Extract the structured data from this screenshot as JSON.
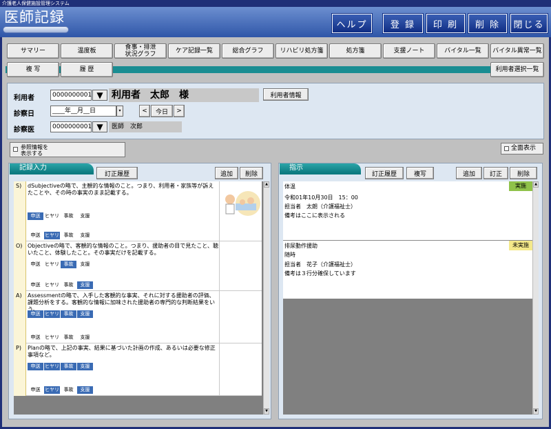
{
  "window": {
    "system_title": "介護老人保健施設管理システム",
    "app_title": "医師記録"
  },
  "header_buttons": {
    "help": "ヘルプ",
    "register": "登 録",
    "print": "印 刷",
    "delete": "削 除",
    "close": "閉じる"
  },
  "tabs_row1": [
    "サマリー",
    "温度板",
    "食事・排泄\n状況グラフ",
    "ケア記録一覧",
    "総合グラフ",
    "リハビリ処方箋",
    "処方箋",
    "支援ノート",
    "バイタル一覧",
    "バイタル異常一覧"
  ],
  "tabs_row2": {
    "copy": "複 写",
    "history": "履 歴",
    "user_select": "利用者選択一覧"
  },
  "user": {
    "label": "利用者",
    "id": "0000000001",
    "name": "利用者　太郎　様",
    "info_button": "利用者情報",
    "date_label": "診察日",
    "date_value": "____年__月__日",
    "prev": "<",
    "today": "今日",
    "next": ">",
    "doctor_label": "診察医",
    "doctor_id": "0000000001",
    "doctor_name": "医師　次郎"
  },
  "options": {
    "reference": "参照情報を\n表示する",
    "fullscreen": "全面表示"
  },
  "record_panel": {
    "title": "記録入力",
    "fix_history": "訂正履歴",
    "add": "追加",
    "delete": "削除",
    "entries": [
      {
        "letter": "S)",
        "text": "dSubjectiveの略で、主観的な情報のこと。つまり、利用者・家族等が訴えたことや、その時の事実のまま記載する。",
        "chips": [
          [
            "申送",
            1
          ],
          [
            "ヒヤリ",
            0
          ],
          [
            "事故",
            0
          ],
          [
            "支援",
            0
          ]
        ],
        "chips2": [
          [
            "申送",
            0
          ],
          [
            "ヒヤリ",
            1
          ],
          [
            "事故",
            0
          ],
          [
            "支援",
            0
          ]
        ]
      },
      {
        "letter": "O)",
        "text": "Objectiveの略で、客観的な情報のこと。つまり、援助者の目で見たこと、聴いたこと、体験したこと。その事実だけを記載する。",
        "chips": [
          [
            "申送",
            0
          ],
          [
            "ヒヤリ",
            0
          ],
          [
            "事故",
            1
          ],
          [
            "支援",
            0
          ]
        ],
        "chips2": [
          [
            "申送",
            0
          ],
          [
            "ヒヤリ",
            0
          ],
          [
            "事故",
            0
          ],
          [
            "支援",
            1
          ]
        ]
      },
      {
        "letter": "A)",
        "text": "Assessmentの略で、入手した客観的な事実、それに対する援助者の評価、課題分析をする。客観的な情報に加味された援助者の専門的な判断結果をいう。",
        "chips": [
          [
            "申送",
            1
          ],
          [
            "ヒヤリ",
            1
          ],
          [
            "事故",
            1
          ],
          [
            "支援",
            1
          ]
        ],
        "chips2": [
          [
            "申送",
            0
          ],
          [
            "ヒヤリ",
            0
          ],
          [
            "事故",
            0
          ],
          [
            "支援",
            0
          ]
        ]
      },
      {
        "letter": "P)",
        "text": "Planの略で、上記の事実、結果に基づいた計画の作成、あるいは必要な修正事項など。",
        "chips": [
          [
            "申送",
            1
          ],
          [
            "ヒヤリ",
            1
          ],
          [
            "事故",
            1
          ],
          [
            "支援",
            1
          ]
        ],
        "chips2": [
          [
            "申送",
            0
          ],
          [
            "ヒヤリ",
            1
          ],
          [
            "事故",
            0
          ],
          [
            "支援",
            1
          ]
        ]
      }
    ]
  },
  "instruction_panel": {
    "title": "指示",
    "fix_history": "訂正履歴",
    "copy": "複写",
    "add": "追加",
    "correct": "訂正",
    "delete": "削除",
    "cards": [
      {
        "title": "体温",
        "status": "実施",
        "status_color": "#8fc24a",
        "line1": "令和01年10月30日　15：00",
        "line2": "担当者　太朗（介護福祉士）",
        "line3": "備考はここに表示される"
      },
      {
        "title": "排尿動作援助",
        "status": "未実施",
        "status_color": "#f4e98a",
        "line1": "随時",
        "line2": "担当者　花子（介護福祉士）",
        "line3": "備考は３行分確保しています"
      }
    ]
  },
  "colors": {
    "accent": "#1a8d92",
    "header": "#2f56a8",
    "chip_active": "#3a6bb4"
  }
}
